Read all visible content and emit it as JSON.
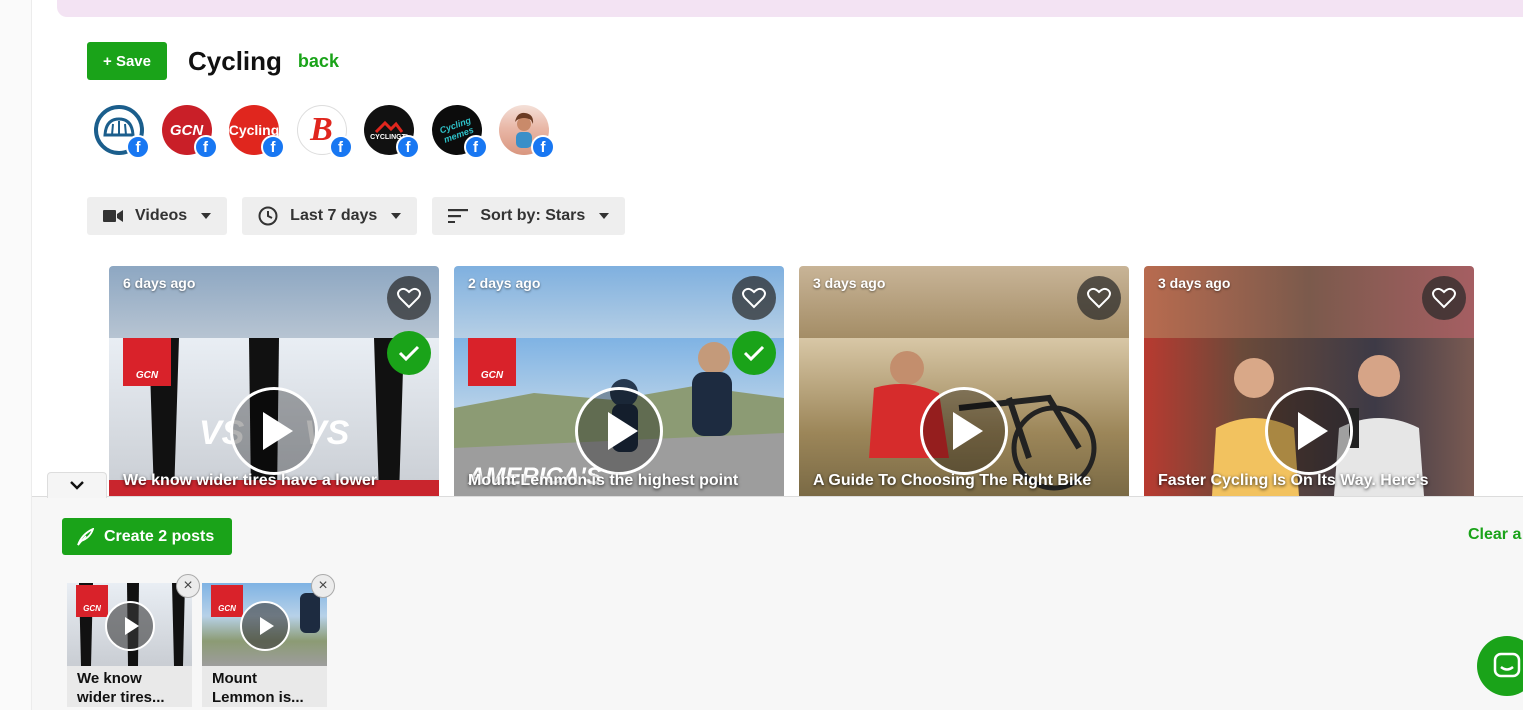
{
  "header": {
    "save_label": "+ Save",
    "title": "Cycling",
    "back_label": "back"
  },
  "sources": [
    {
      "name": "cycling-helmet-page",
      "label": "",
      "bg": "#ffffff",
      "fg": "#1b5e8c"
    },
    {
      "name": "gcn-page",
      "label": "GCN",
      "bg": "#c91f28",
      "fg": "#ffffff"
    },
    {
      "name": "cycling-weekly-page",
      "label": "Cycling",
      "bg": "#e0261e",
      "fg": "#ffffff"
    },
    {
      "name": "bicycling-page",
      "label": "B",
      "bg": "#ffffff",
      "fg": "#e0261e"
    },
    {
      "name": "cyclingtips-page",
      "label": "CYCLINGTI",
      "bg": "#111111",
      "fg": "#ffffff"
    },
    {
      "name": "cycling-memes-page",
      "label": "Cycling memes",
      "bg": "#0c0c0c",
      "fg": "#2ec2c9"
    },
    {
      "name": "magazine-page",
      "label": "",
      "bg": "#f0c8c8",
      "fg": "#c33"
    }
  ],
  "filters": {
    "type": "Videos",
    "period": "Last 7 days",
    "sort": "Sort by: Stars"
  },
  "cards": [
    {
      "age": "6 days ago",
      "caption": "We know wider tires have a lower",
      "selected": true,
      "has_gcn": true,
      "tint": "#7b8fa6",
      "scene": "#d0d4da"
    },
    {
      "age": "2 days ago",
      "caption": "Mount Lemmon is the highest point",
      "selected": true,
      "has_gcn": true,
      "tint": "#6f9bc6",
      "scene": "#4b7aa8"
    },
    {
      "age": "3 days ago",
      "caption": "A Guide To Choosing The Right Bike",
      "selected": false,
      "has_gcn": false,
      "tint": "#b49a76",
      "scene": "#9c8659"
    },
    {
      "age": "3 days ago",
      "caption": "Faster Cycling Is On Its Way. Here's",
      "selected": false,
      "has_gcn": false,
      "tint": "#a06a5b",
      "scene": "#5a3e36"
    }
  ],
  "tray": {
    "create_label": "Create 2 posts",
    "clear_label": "Clear a",
    "selected": [
      {
        "title_line1": "We know",
        "title_line2": "wider tires..."
      },
      {
        "title_line1": "Mount",
        "title_line2": "Lemmon is..."
      }
    ]
  },
  "colors": {
    "accent": "#1aa319",
    "facebook": "#1877f2",
    "banner": "#f3e3f3"
  }
}
